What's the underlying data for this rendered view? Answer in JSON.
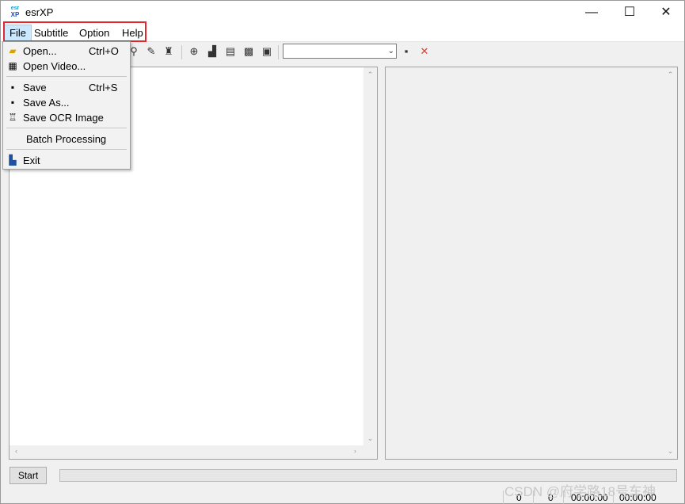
{
  "window": {
    "title": "esrXP",
    "app_icon_top": "esr",
    "app_icon_bottom": "XP"
  },
  "controls": {
    "minimize": "—",
    "maximize": "☐",
    "close": "✕"
  },
  "menu": {
    "items": [
      {
        "label": "File"
      },
      {
        "label": "Subtitle"
      },
      {
        "label": "Option"
      },
      {
        "label": "Help"
      }
    ]
  },
  "file_menu": {
    "items": [
      {
        "label": "Open...",
        "shortcut": "Ctrl+O",
        "icon": "open-folder-icon"
      },
      {
        "label": "Open Video...",
        "shortcut": "",
        "icon": "video-icon"
      },
      {
        "label": "Save",
        "shortcut": "Ctrl+S",
        "icon": "floppy-disk-icon"
      },
      {
        "label": "Save As...",
        "shortcut": "",
        "icon": "save-as-icon"
      },
      {
        "label": "Save OCR Image",
        "shortcut": "",
        "icon": "ocr-image-icon"
      },
      {
        "label": "Batch Processing",
        "shortcut": ""
      },
      {
        "label": "Exit",
        "shortcut": "",
        "icon": "exit-door-icon"
      }
    ]
  },
  "toolbar": {
    "icons": [
      "magnifier-icon",
      "edit-page-icon",
      "trophy-icon",
      "zoom-in-icon",
      "stairs-icon",
      "document-icon",
      "color-palette-icon",
      "text-image-icon"
    ],
    "combo_value": "",
    "save_icon": "floppy-disk-icon",
    "delete_icon": "red-x-icon"
  },
  "footer": {
    "start_label": "Start",
    "progress": 0,
    "status": {
      "count1": "0",
      "count2": "0",
      "time1": "00:00:00",
      "time2": "00:00:00"
    }
  },
  "watermark": "CSDN @府学路18号车神"
}
